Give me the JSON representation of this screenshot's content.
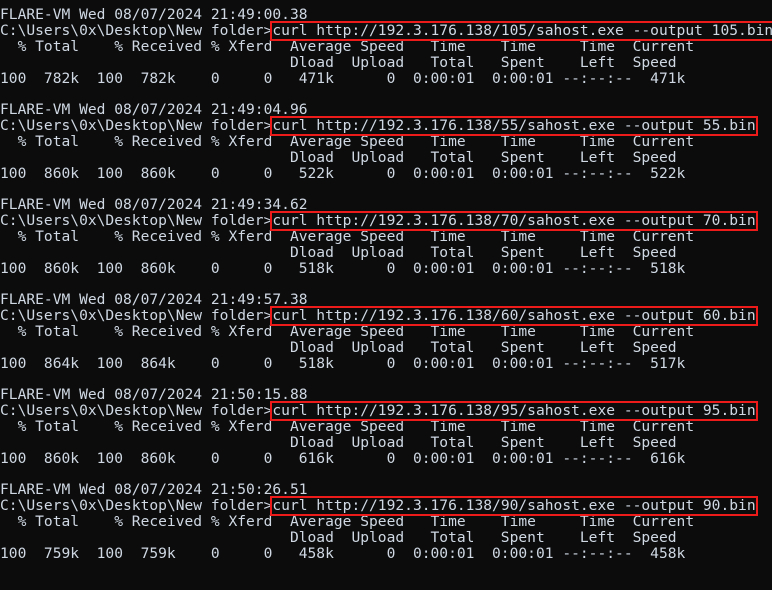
{
  "terminal": {
    "prompt_host": "FLARE-VM",
    "prompt_path": "C:\\Users\\0x\\Desktop\\New folder>",
    "background_color": "#0c0c0c",
    "text_color": "#cfd8e3",
    "highlight_color": "#ee1b1b",
    "header_line_1": "  % Total    % Received % Xferd  Average Speed   Time    Time     Time  Current",
    "header_line_2": "                                 Dload  Upload   Total   Spent    Left  Speed"
  },
  "blocks": [
    {
      "banner": "FLARE-VM Wed 08/07/2024 21:49:00.38",
      "prompt": "C:\\Users\\0x\\Desktop\\New folder>",
      "command": "curl http://192.3.176.138/105/sahost.exe --output 105.bin",
      "url": "http://192.3.176.138/105/sahost.exe",
      "output_file": "105.bin",
      "stats": {
        "percent_total": "100",
        "total": "782k",
        "percent_received": "100",
        "received": "782k",
        "percent_xferd": "0",
        "xferd": "0",
        "dload": "471k",
        "upload": "0",
        "time_total": "0:00:01",
        "time_spent": "0:00:01",
        "time_left": "--:--:--",
        "current_speed": "471k"
      },
      "stats_line": "100  782k  100  782k    0     0   471k      0  0:00:01  0:00:01 --:--:--  471k"
    },
    {
      "banner": "FLARE-VM Wed 08/07/2024 21:49:04.96",
      "prompt": "C:\\Users\\0x\\Desktop\\New folder>",
      "command": "curl http://192.3.176.138/55/sahost.exe --output 55.bin",
      "url": "http://192.3.176.138/55/sahost.exe",
      "output_file": "55.bin",
      "stats": {
        "percent_total": "100",
        "total": "860k",
        "percent_received": "100",
        "received": "860k",
        "percent_xferd": "0",
        "xferd": "0",
        "dload": "522k",
        "upload": "0",
        "time_total": "0:00:01",
        "time_spent": "0:00:01",
        "time_left": "--:--:--",
        "current_speed": "522k"
      },
      "stats_line": "100  860k  100  860k    0     0   522k      0  0:00:01  0:00:01 --:--:--  522k"
    },
    {
      "banner": "FLARE-VM Wed 08/07/2024 21:49:34.62",
      "prompt": "C:\\Users\\0x\\Desktop\\New folder>",
      "command": "curl http://192.3.176.138/70/sahost.exe --output 70.bin",
      "url": "http://192.3.176.138/70/sahost.exe",
      "output_file": "70.bin",
      "stats": {
        "percent_total": "100",
        "total": "860k",
        "percent_received": "100",
        "received": "860k",
        "percent_xferd": "0",
        "xferd": "0",
        "dload": "518k",
        "upload": "0",
        "time_total": "0:00:01",
        "time_spent": "0:00:01",
        "time_left": "--:--:--",
        "current_speed": "518k"
      },
      "stats_line": "100  860k  100  860k    0     0   518k      0  0:00:01  0:00:01 --:--:--  518k"
    },
    {
      "banner": "FLARE-VM Wed 08/07/2024 21:49:57.38",
      "prompt": "C:\\Users\\0x\\Desktop\\New folder>",
      "command": "curl http://192.3.176.138/60/sahost.exe --output 60.bin",
      "url": "http://192.3.176.138/60/sahost.exe",
      "output_file": "60.bin",
      "stats": {
        "percent_total": "100",
        "total": "864k",
        "percent_received": "100",
        "received": "864k",
        "percent_xferd": "0",
        "xferd": "0",
        "dload": "518k",
        "upload": "0",
        "time_total": "0:00:01",
        "time_spent": "0:00:01",
        "time_left": "--:--:--",
        "current_speed": "517k"
      },
      "stats_line": "100  864k  100  864k    0     0   518k      0  0:00:01  0:00:01 --:--:--  517k"
    },
    {
      "banner": "FLARE-VM Wed 08/07/2024 21:50:15.88",
      "prompt": "C:\\Users\\0x\\Desktop\\New folder>",
      "command": "curl http://192.3.176.138/95/sahost.exe --output 95.bin",
      "url": "http://192.3.176.138/95/sahost.exe",
      "output_file": "95.bin",
      "stats": {
        "percent_total": "100",
        "total": "860k",
        "percent_received": "100",
        "received": "860k",
        "percent_xferd": "0",
        "xferd": "0",
        "dload": "616k",
        "upload": "0",
        "time_total": "0:00:01",
        "time_spent": "0:00:01",
        "time_left": "--:--:--",
        "current_speed": "616k"
      },
      "stats_line": "100  860k  100  860k    0     0   616k      0  0:00:01  0:00:01 --:--:--  616k"
    },
    {
      "banner": "FLARE-VM Wed 08/07/2024 21:50:26.51",
      "prompt": "C:\\Users\\0x\\Desktop\\New folder>",
      "command": "curl http://192.3.176.138/90/sahost.exe --output 90.bin",
      "url": "http://192.3.176.138/90/sahost.exe",
      "output_file": "90.bin",
      "stats": {
        "percent_total": "100",
        "total": "759k",
        "percent_received": "100",
        "received": "759k",
        "percent_xferd": "0",
        "xferd": "0",
        "dload": "458k",
        "upload": "0",
        "time_total": "0:00:01",
        "time_spent": "0:00:01",
        "time_left": "--:--:--",
        "current_speed": "458k"
      },
      "stats_line": "100  759k  100  759k    0     0   458k      0  0:00:01  0:00:01 --:--:--  458k"
    }
  ]
}
